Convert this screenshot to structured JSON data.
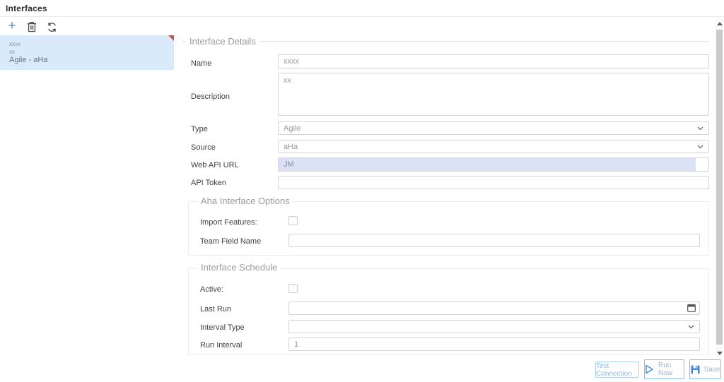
{
  "window": {
    "title": "Interfaces"
  },
  "toolbar": {
    "add_icon": "add-plus",
    "delete_icon": "trash",
    "refresh_icon": "refresh-arrows"
  },
  "interface_list": {
    "selected_item": {
      "lines": [
        "xxxx",
        "xx",
        "Agile - aHa"
      ],
      "has_unsaved_flag": true
    }
  },
  "details": {
    "section_title": "Interface Details",
    "name": {
      "label": "Name",
      "value": "xxxx"
    },
    "description": {
      "label": "Description",
      "value": "xx"
    },
    "type": {
      "label": "Type",
      "value": "Agile"
    },
    "source": {
      "label": "Source",
      "value": "aHa"
    },
    "web_api_url": {
      "label": "Web API URL",
      "value": "JM"
    },
    "api_token": {
      "label": "API Token",
      "value": ""
    }
  },
  "aha_options": {
    "section_title": "Aha Interface Options",
    "import_features": {
      "label": "Import Features:",
      "checked": false
    },
    "team_field_name": {
      "label": "Team Field Name",
      "value": ""
    }
  },
  "schedule": {
    "section_title": "Interface Schedule",
    "active": {
      "label": "Active:",
      "checked": false
    },
    "last_run": {
      "label": "Last Run",
      "value": ""
    },
    "interval_type": {
      "label": "Interval Type",
      "value": ""
    },
    "run_interval": {
      "label": "Run Interval",
      "value": "1"
    }
  },
  "footer": {
    "test_connection_label": "Test Connection",
    "run_now_label": "Run Now",
    "save_label": "Save"
  },
  "colors": {
    "accent_blue": "#4a90d9",
    "list_selection_bg": "#d9eafb",
    "text_selection_bg": "#dce2f6",
    "flag_red": "#bf5450",
    "input_border": "#d4d4d4",
    "section_header_text": "#9b9b9b"
  }
}
